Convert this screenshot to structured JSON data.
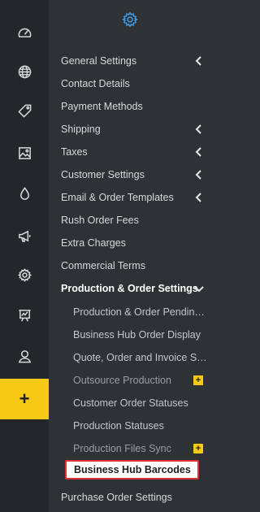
{
  "colors": {
    "rail_bg": "#24272a",
    "panel_bg": "#2f3235",
    "accent_blue": "#3f97e3",
    "accent_yellow": "#f6c917",
    "highlight_border": "#e0303a"
  },
  "rail": {
    "items": [
      {
        "icon": "dashboard-gauge-icon"
      },
      {
        "icon": "globe-icon"
      },
      {
        "icon": "tag-icon"
      },
      {
        "icon": "image-icon"
      },
      {
        "icon": "drop-icon"
      },
      {
        "icon": "megaphone-icon"
      },
      {
        "icon": "gear-icon"
      },
      {
        "icon": "presentation-chart-icon"
      },
      {
        "icon": "user-icon"
      }
    ],
    "add_label": "+"
  },
  "panel": {
    "header_icon": "gear-icon",
    "menu": [
      {
        "label": "General Settings",
        "chevron": "left"
      },
      {
        "label": "Contact Details"
      },
      {
        "label": "Payment Methods"
      },
      {
        "label": "Shipping",
        "chevron": "left"
      },
      {
        "label": "Taxes",
        "chevron": "left"
      },
      {
        "label": "Customer Settings",
        "chevron": "left"
      },
      {
        "label": "Email & Order Templates",
        "chevron": "left"
      },
      {
        "label": "Rush Order Fees"
      },
      {
        "label": "Extra Charges"
      },
      {
        "label": "Commercial Terms"
      },
      {
        "label": "Production & Order Settings",
        "chevron": "down"
      }
    ],
    "submenu": [
      {
        "label": "Production & Order Pending ..."
      },
      {
        "label": "Business Hub Order Display"
      },
      {
        "label": "Quote, Order and Invoice Set..."
      },
      {
        "label": "Outsource Production",
        "badge": "+"
      },
      {
        "label": "Customer Order Statuses"
      },
      {
        "label": "Production Statuses"
      },
      {
        "label": "Production Files Sync",
        "badge": "+"
      },
      {
        "label": "Business Hub Barcodes"
      }
    ],
    "after": [
      {
        "label": "Purchase Order Settings"
      }
    ]
  }
}
